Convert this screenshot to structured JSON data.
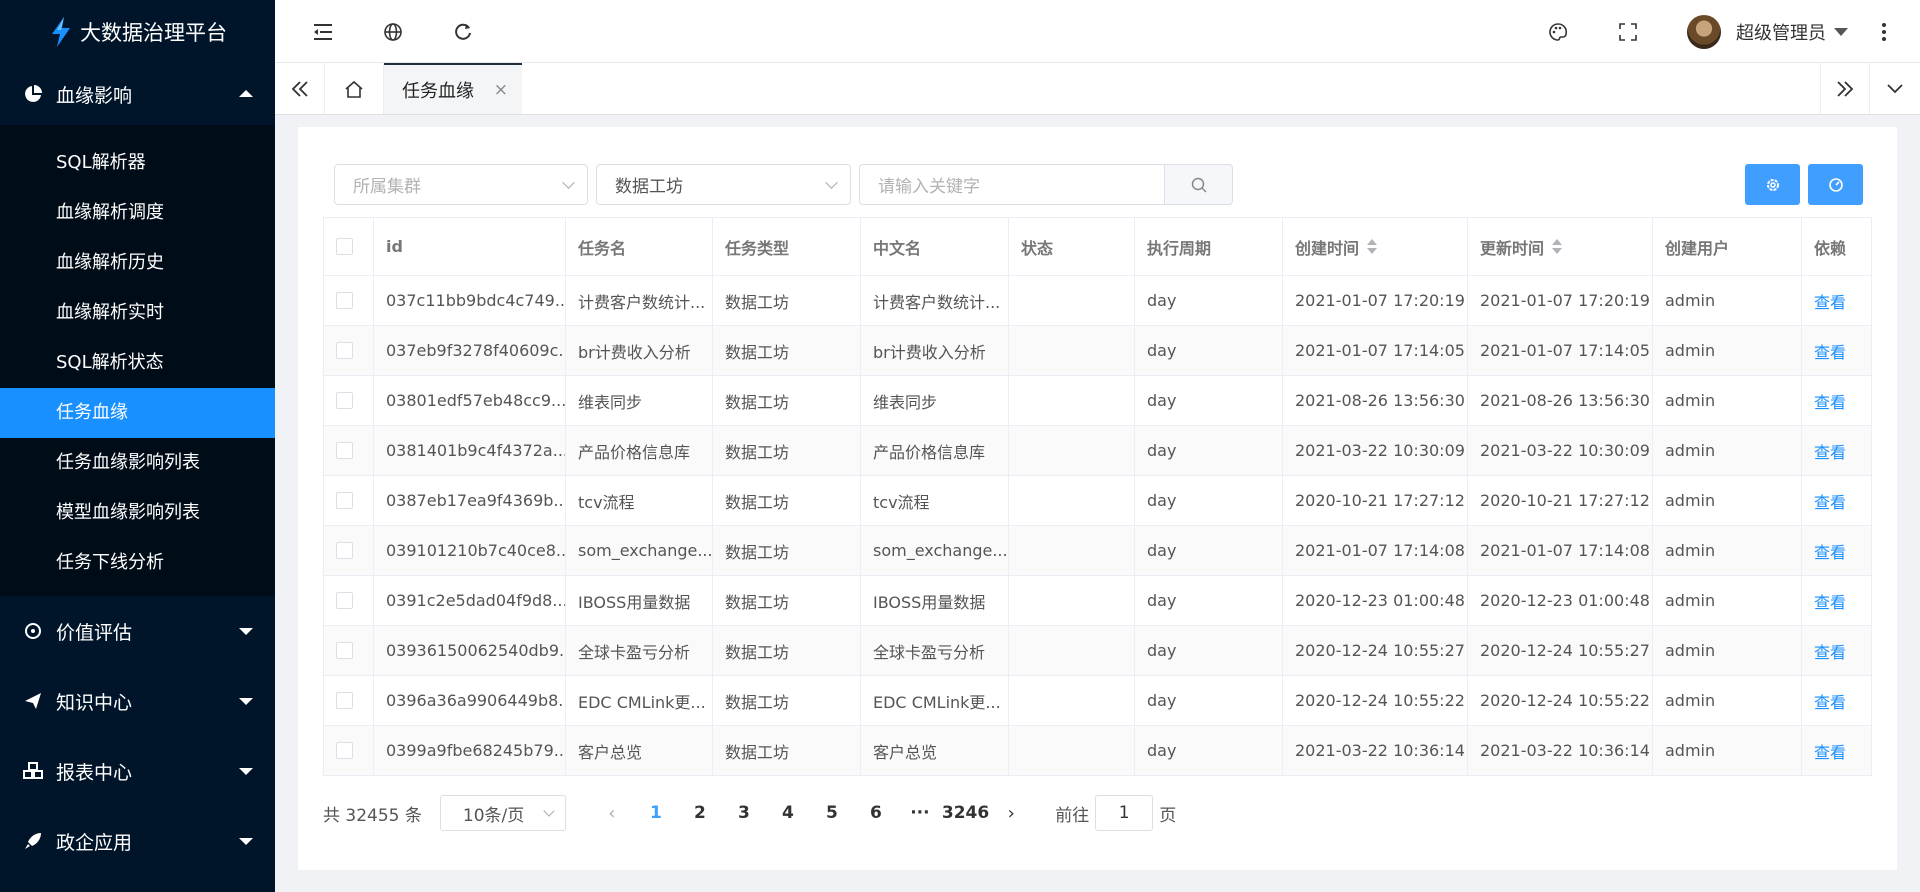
{
  "app": {
    "title": "大数据治理平台"
  },
  "sidebar": {
    "open_group": {
      "label": "血缘影响",
      "icon": "pie-chart-icon"
    },
    "sub_items": [
      {
        "label": "SQL解析器"
      },
      {
        "label": "血缘解析调度"
      },
      {
        "label": "血缘解析历史"
      },
      {
        "label": "血缘解析实时"
      },
      {
        "label": "SQL解析状态"
      },
      {
        "label": "任务血缘",
        "active": true
      },
      {
        "label": "任务血缘影响列表"
      },
      {
        "label": "模型血缘影响列表"
      },
      {
        "label": "任务下线分析"
      }
    ],
    "groups": [
      {
        "label": "价值评估",
        "icon": "target-icon"
      },
      {
        "label": "知识中心",
        "icon": "paper-plane-icon"
      },
      {
        "label": "报表中心",
        "icon": "cubes-icon"
      },
      {
        "label": "政企应用",
        "icon": "rocket-icon"
      }
    ]
  },
  "header": {
    "icons": [
      "menu-fold-icon",
      "globe-icon",
      "refresh-icon",
      "palette-icon",
      "fullscreen-icon",
      "more-vertical-icon"
    ],
    "user": {
      "name": "超级管理员"
    }
  },
  "tabs": {
    "active_label": "任务血缘",
    "close_symbol": "×"
  },
  "filters": {
    "cluster_placeholder": "所属集群",
    "workshop_value": "数据工坊",
    "keyword_placeholder": "请输入关键字"
  },
  "colors": {
    "sidebar_bg": "#001529",
    "accent": "#1890ff",
    "button": "#409eff"
  },
  "table": {
    "columns": [
      "id",
      "任务名",
      "任务类型",
      "中文名",
      "状态",
      "执行周期",
      "创建时间",
      "更新时间",
      "创建用户",
      "依赖"
    ],
    "rows": [
      {
        "id": "037c11bb9bdc4c749...",
        "name": "计费客户数统计...",
        "type": "数据工坊",
        "cn": "计费客户数统计...",
        "status": "",
        "cycle": "day",
        "created": "2021-01-07 17:20:19",
        "updated": "2021-01-07 17:20:19",
        "user": "admin",
        "dep": "查看"
      },
      {
        "id": "037eb9f3278f40609c...",
        "name": "br计费收入分析",
        "type": "数据工坊",
        "cn": "br计费收入分析",
        "status": "",
        "cycle": "day",
        "created": "2021-01-07 17:14:05",
        "updated": "2021-01-07 17:14:05",
        "user": "admin",
        "dep": "查看"
      },
      {
        "id": "03801edf57eb48cc9...",
        "name": "维表同步",
        "type": "数据工坊",
        "cn": "维表同步",
        "status": "",
        "cycle": "day",
        "created": "2021-08-26 13:56:30",
        "updated": "2021-08-26 13:56:30",
        "user": "admin",
        "dep": "查看"
      },
      {
        "id": "0381401b9c4f4372a...",
        "name": "产品价格信息库",
        "type": "数据工坊",
        "cn": "产品价格信息库",
        "status": "",
        "cycle": "day",
        "created": "2021-03-22 10:30:09",
        "updated": "2021-03-22 10:30:09",
        "user": "admin",
        "dep": "查看"
      },
      {
        "id": "0387eb17ea9f4369b...",
        "name": "tcv流程",
        "type": "数据工坊",
        "cn": "tcv流程",
        "status": "",
        "cycle": "day",
        "created": "2020-10-21 17:27:12",
        "updated": "2020-10-21 17:27:12",
        "user": "admin",
        "dep": "查看"
      },
      {
        "id": "039101210b7c40ce8...",
        "name": "som_exchange...",
        "type": "数据工坊",
        "cn": "som_exchange...",
        "status": "",
        "cycle": "day",
        "created": "2021-01-07 17:14:08",
        "updated": "2021-01-07 17:14:08",
        "user": "admin",
        "dep": "查看"
      },
      {
        "id": "0391c2e5dad04f9d8...",
        "name": "IBOSS用量数据",
        "type": "数据工坊",
        "cn": "IBOSS用量数据",
        "status": "",
        "cycle": "day",
        "created": "2020-12-23 01:00:48",
        "updated": "2020-12-23 01:00:48",
        "user": "admin",
        "dep": "查看"
      },
      {
        "id": "03936150062540db9...",
        "name": "全球卡盈亏分析",
        "type": "数据工坊",
        "cn": "全球卡盈亏分析",
        "status": "",
        "cycle": "day",
        "created": "2020-12-24 10:55:27",
        "updated": "2020-12-24 10:55:27",
        "user": "admin",
        "dep": "查看"
      },
      {
        "id": "0396a36a9906449b8...",
        "name": "EDC CMLink更...",
        "type": "数据工坊",
        "cn": "EDC CMLink更...",
        "status": "",
        "cycle": "day",
        "created": "2020-12-24 10:55:22",
        "updated": "2020-12-24 10:55:22",
        "user": "admin",
        "dep": "查看"
      },
      {
        "id": "0399a9fbe68245b79...",
        "name": "客户总览",
        "type": "数据工坊",
        "cn": "客户总览",
        "status": "",
        "cycle": "day",
        "created": "2021-03-22 10:36:14",
        "updated": "2021-03-22 10:36:14",
        "user": "admin",
        "dep": "查看"
      }
    ]
  },
  "pagination": {
    "total_text": "共 32455 条",
    "page_size": "10条/页",
    "pages": [
      "1",
      "2",
      "3",
      "4",
      "5",
      "6",
      "···",
      "3246"
    ],
    "current": "1",
    "prev": "‹",
    "next": "›",
    "goto_label": "前往",
    "goto_value": "1",
    "goto_suffix": "页"
  }
}
